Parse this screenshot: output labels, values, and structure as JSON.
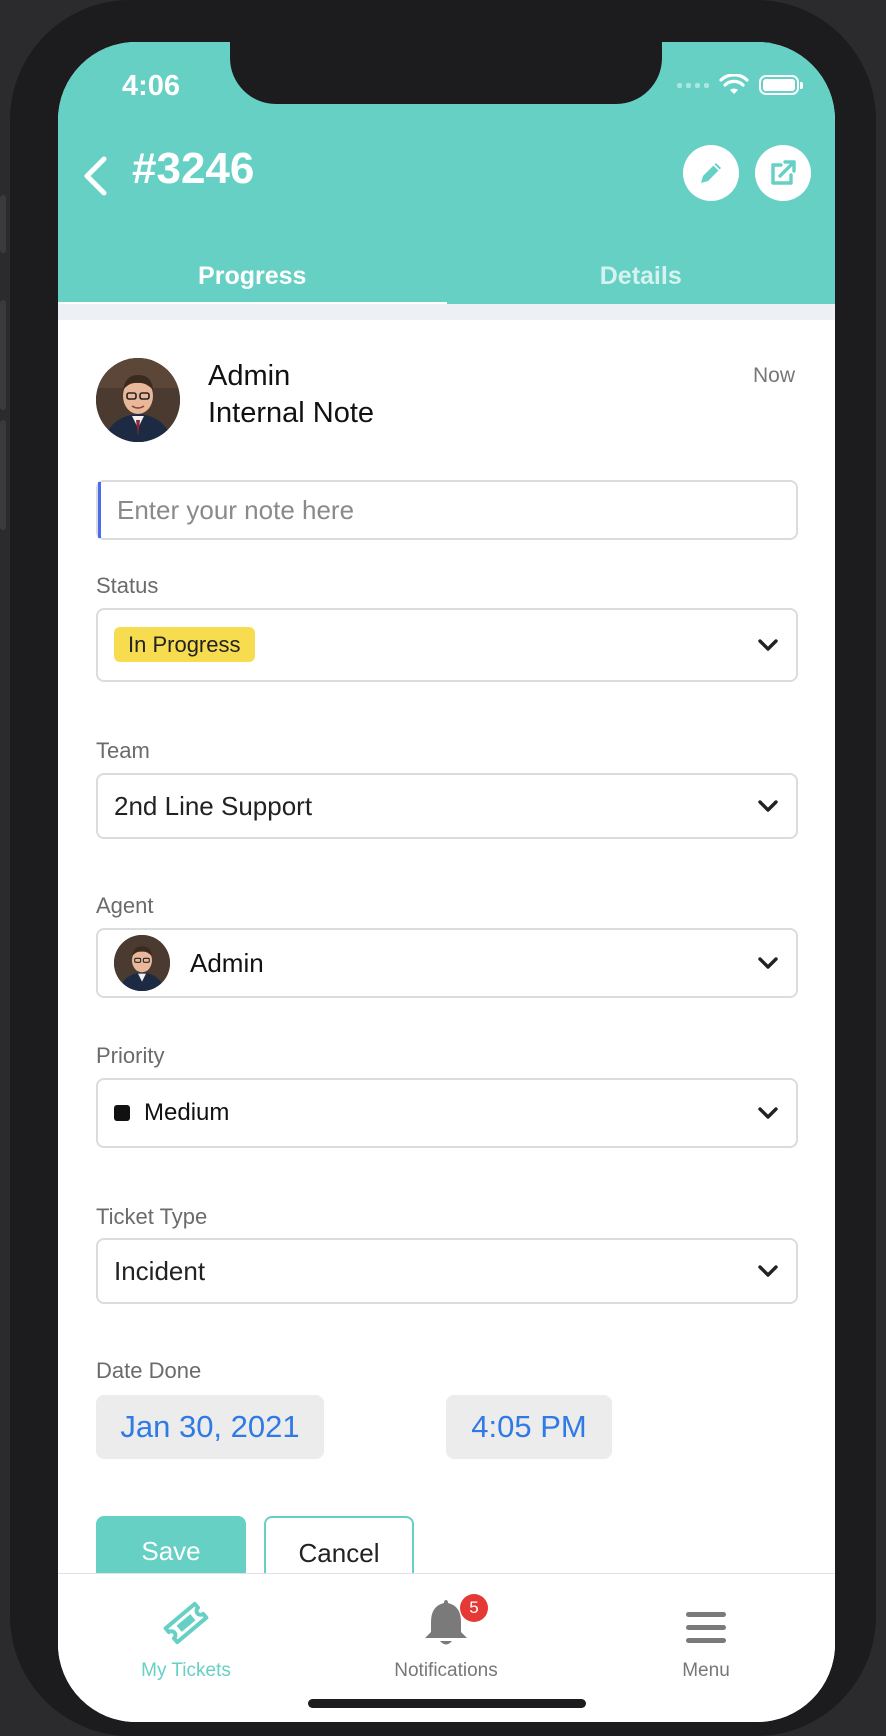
{
  "status_bar": {
    "time": "4:06"
  },
  "header": {
    "title": "#3246",
    "tabs": [
      {
        "label": "Progress",
        "active": true
      },
      {
        "label": "Details",
        "active": false
      }
    ]
  },
  "note": {
    "author": "Admin",
    "type": "Internal Note",
    "time": "Now",
    "placeholder": "Enter your note here"
  },
  "fields": {
    "status": {
      "label": "Status",
      "value": "In Progress",
      "color": "#f7dc4f"
    },
    "team": {
      "label": "Team",
      "value": "2nd Line Support"
    },
    "agent": {
      "label": "Agent",
      "value": "Admin"
    },
    "priority": {
      "label": "Priority",
      "value": "Medium"
    },
    "ticket_type": {
      "label": "Ticket Type",
      "value": "Incident"
    },
    "date_done": {
      "label": "Date Done",
      "date": "Jan 30, 2021",
      "time": "4:05 PM"
    }
  },
  "actions": {
    "save": "Save",
    "cancel": "Cancel"
  },
  "bottom_nav": {
    "items": [
      {
        "label": "My Tickets",
        "icon": "ticket-icon",
        "active": true
      },
      {
        "label": "Notifications",
        "icon": "bell-icon",
        "badge": "5"
      },
      {
        "label": "Menu",
        "icon": "hamburger-icon"
      }
    ]
  },
  "colors": {
    "accent": "#66d0c4",
    "link": "#2f7ae5",
    "badge": "#e53935"
  }
}
